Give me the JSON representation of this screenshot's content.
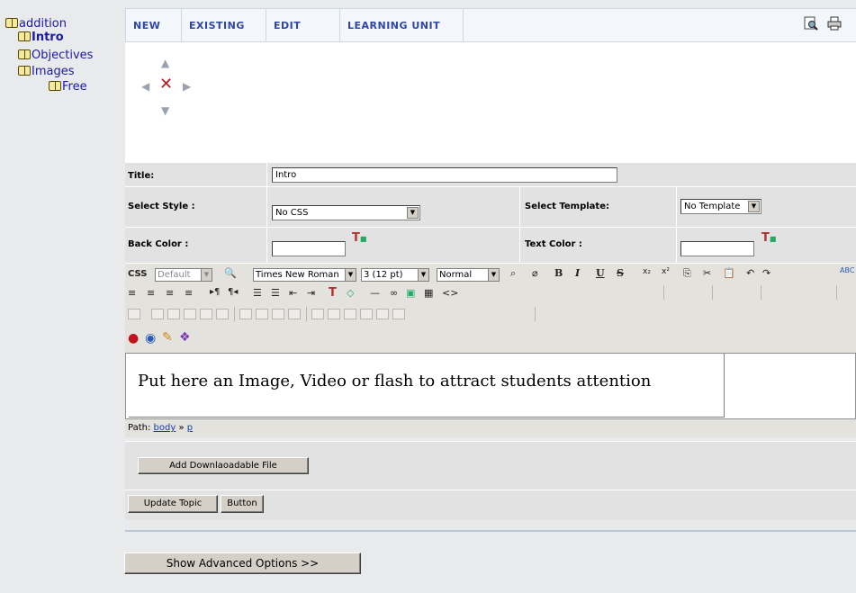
{
  "sidebar": {
    "items": [
      {
        "label": "addition",
        "bold": false
      },
      {
        "label": "Intro",
        "bold": true
      },
      {
        "label": "Objectives",
        "bold": false
      },
      {
        "label": "Images",
        "bold": false
      },
      {
        "label": "Free",
        "bold": false
      }
    ]
  },
  "nav": {
    "tabs": [
      "NEW",
      "EXISTING",
      "EDIT",
      "LEARNING UNIT"
    ],
    "icons": [
      "preview-icon",
      "print-icon"
    ]
  },
  "form": {
    "title_label": "Title:",
    "title_value": "Intro",
    "style_label": "Select Style :",
    "style_value": "No CSS",
    "template_label": "Select Template:",
    "template_value": "No Template",
    "back_color_label": "Back Color :",
    "text_color_label": "Text Color :"
  },
  "toolbar": {
    "css_label": "CSS",
    "css_value": "Default",
    "font_value": "Times New Roman",
    "size_value": "3 (12 pt)",
    "format_value": "Normal",
    "bold": "B",
    "italic": "I",
    "underline": "U",
    "strike": "S"
  },
  "editor": {
    "content": "Put here an Image, Video or flash to attract students attention",
    "path_label": "Path:",
    "path_body": "body",
    "path_sep": "»",
    "path_p": "p"
  },
  "buttons": {
    "add_file": "Add Downlaoadable File",
    "update_topic": "Update Topic",
    "button": "Button",
    "advanced": "Show Advanced Options >>"
  },
  "colors": {
    "nav_text": "#2f47a4",
    "tree_link": "#1a1aa6",
    "delete_x": "#c0141a"
  }
}
